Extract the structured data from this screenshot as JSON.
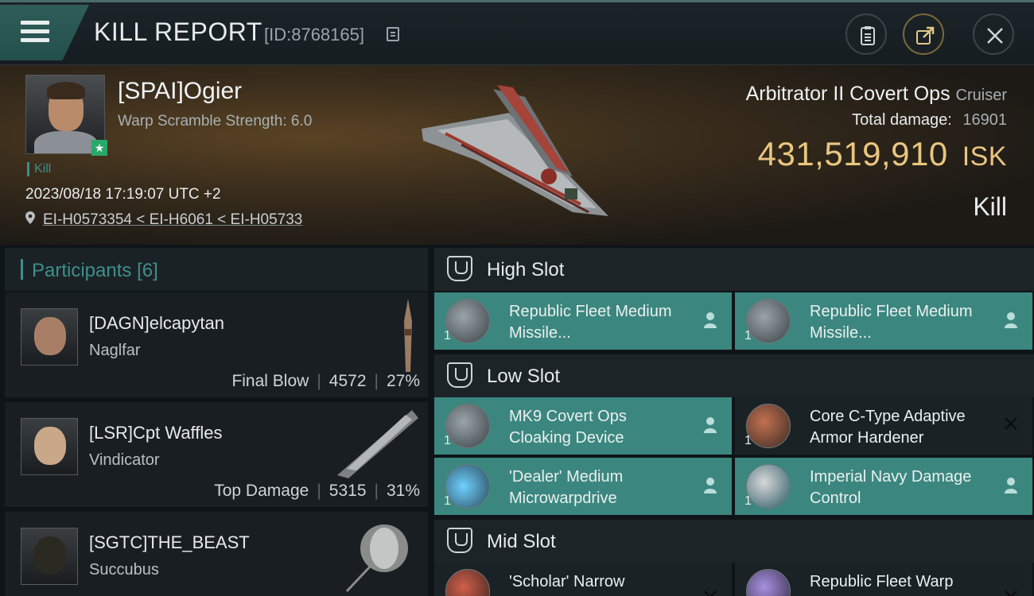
{
  "header": {
    "title": "KILL REPORT",
    "id_label": "[ID:8768165]"
  },
  "hero": {
    "pilot_name": "[SPAI]Ogier",
    "warp_scramble": "Warp Scramble Strength: 6.0",
    "kill_tag": "Kill",
    "datetime": "2023/08/18 17:19:07 UTC +2",
    "location": "EI-H0573354 < EI-H6061 < EI-H05733",
    "ship_name": "Arbitrator II Covert Ops",
    "ship_class": "Cruiser",
    "total_damage_label": "Total damage:",
    "total_damage_value": "16901",
    "isk_value": "431,519,910",
    "isk_unit": "ISK",
    "result": "Kill"
  },
  "participants": {
    "title": "Participants",
    "count": "[6]",
    "items": [
      {
        "name": "[DAGN]elcapytan",
        "ship": "Naglfar",
        "role": "Final Blow",
        "damage": "4572",
        "percent": "27%"
      },
      {
        "name": "[LSR]Cpt Waffles",
        "ship": "Vindicator",
        "role": "Top Damage",
        "damage": "5315",
        "percent": "31%"
      },
      {
        "name": "[SGTC]THE_BEAST",
        "ship": "Succubus",
        "role": "",
        "damage": "",
        "percent": ""
      }
    ]
  },
  "fitting": {
    "high_label": "High Slot",
    "low_label": "Low Slot",
    "mid_label": "Mid Slot",
    "high": [
      {
        "name": "Republic Fleet Medium Missile...",
        "qty": "1",
        "status": "destroyed"
      },
      {
        "name": "Republic Fleet Medium Missile...",
        "qty": "1",
        "status": "destroyed"
      }
    ],
    "low": [
      {
        "name": "MK9 Covert Ops Cloaking Device",
        "qty": "1",
        "status": "destroyed"
      },
      {
        "name": "Core C-Type Adaptive Armor Hardener",
        "qty": "1",
        "status": "dropped"
      },
      {
        "name": "'Dealer' Medium Microwarpdrive",
        "qty": "1",
        "status": "destroyed"
      },
      {
        "name": "Imperial Navy Damage Control",
        "qty": "1",
        "status": "destroyed"
      }
    ],
    "mid": [
      {
        "name": "'Scholar' Narrow",
        "qty": "",
        "status": "dropped"
      },
      {
        "name": "Republic Fleet Warp",
        "qty": "",
        "status": "dropped"
      }
    ]
  },
  "colors": {
    "accent_teal": "#3e8f8a",
    "destroyed_bg": "#3b877f",
    "isk_gold": "#e9c680"
  }
}
